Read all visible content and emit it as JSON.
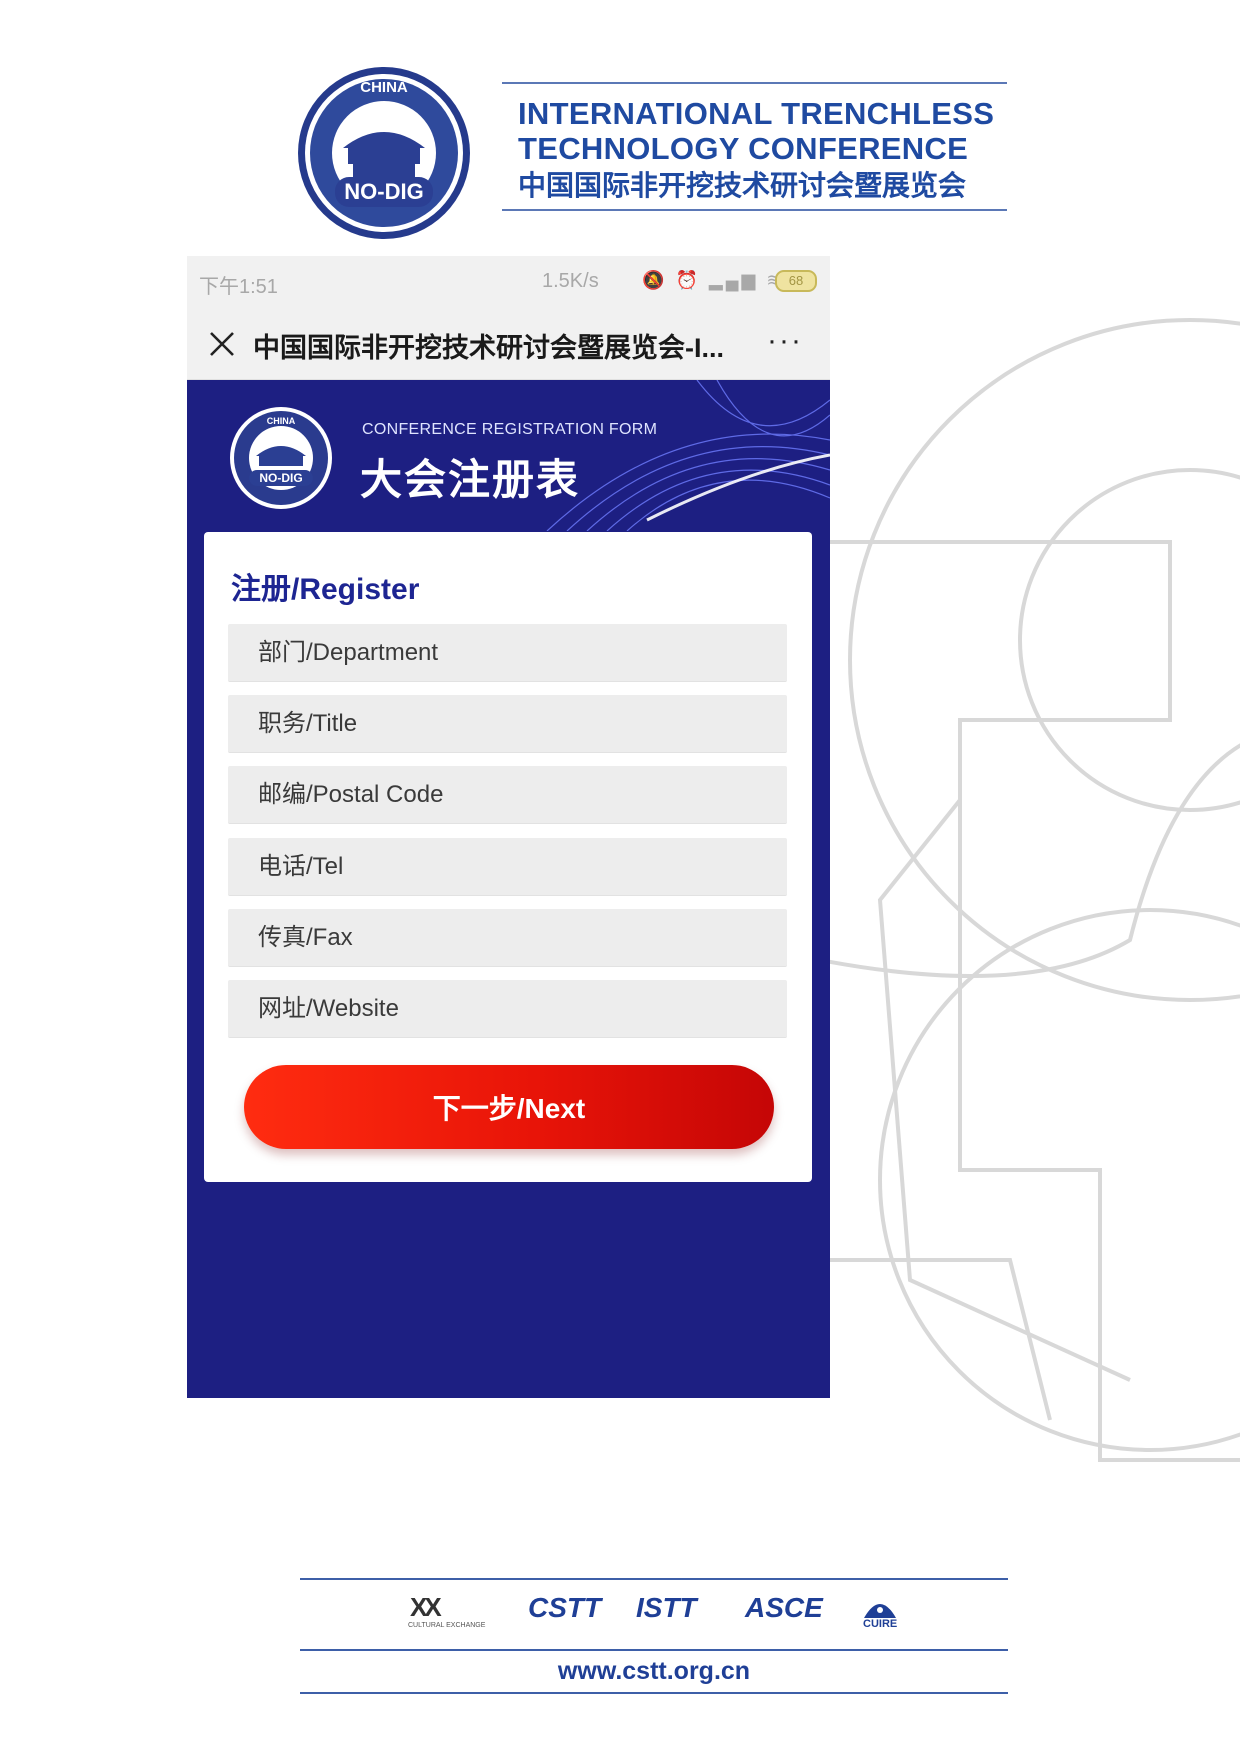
{
  "header": {
    "logo_text": {
      "top": "CHINA",
      "middle": "NO-DIG",
      "ring": "INTERNATIONAL TRENCHLESS TECHNOLOGY CONFERENCE"
    },
    "title_en_line1": "INTERNATIONAL TRENCHLESS",
    "title_en_line2": "TECHNOLOGY CONFERENCE",
    "title_cn": "中国国际非开挖技术研讨会暨展览会"
  },
  "phone": {
    "status_bar": {
      "time": "下午1:51",
      "speed": "1.5K/s",
      "battery": "68"
    },
    "nav": {
      "title": "中国国际非开挖技术研讨会暨展览会-I...",
      "more": "···"
    },
    "banner": {
      "subtitle": "CONFERENCE REGISTRATION FORM",
      "title": "大会注册表"
    },
    "form": {
      "heading": "注册/Register",
      "fields": [
        {
          "placeholder": "部门/Department"
        },
        {
          "placeholder": "职务/Title"
        },
        {
          "placeholder": "邮编/Postal Code"
        },
        {
          "placeholder": "电话/Tel"
        },
        {
          "placeholder": "传真/Fax"
        },
        {
          "placeholder": "网址/Website"
        }
      ],
      "next_label": "下一步/Next"
    }
  },
  "footer": {
    "sponsors": [
      {
        "name": "XX",
        "sub": "CULTURAL EXCHANGE"
      },
      {
        "name": "CSTT"
      },
      {
        "name": "ISTT"
      },
      {
        "name": "ASCE"
      },
      {
        "name": "CUIRE"
      }
    ],
    "url": "www.cstt.org.cn"
  },
  "colors": {
    "navy": "#1d1f82",
    "brand_blue": "#1f4aa1",
    "button_red": "#e81408"
  }
}
